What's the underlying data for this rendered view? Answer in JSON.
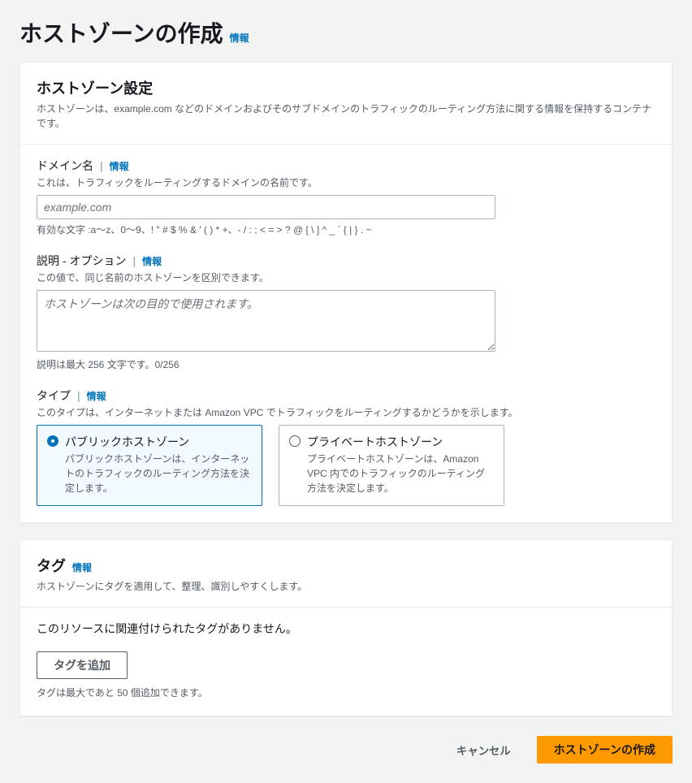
{
  "header": {
    "title": "ホストゾーンの作成",
    "info": "情報"
  },
  "config": {
    "title": "ホストゾーン設定",
    "desc": "ホストゾーンは、example.com などのドメインおよびそのサブドメインのトラフィックのルーティング方法に関する情報を保持するコンテナです。",
    "domain": {
      "label": "ドメイン名",
      "info": "情報",
      "help": "これは、トラフィックをルーティングするドメインの名前です。",
      "placeholder": "example.com",
      "constraint": "有効な文字 :a～z、0～9、! \" # $ % & ' ( ) * +、- / : ; < = > ? @ [ \\ ] ^ _ ` { | } . ~"
    },
    "description": {
      "label": "説明 - オプション",
      "info": "情報",
      "help": "この値で、同じ名前のホストゾーンを区別できます。",
      "placeholder": "ホストゾーンは次の目的で使用されます。",
      "constraint": "説明は最大 256 文字です。0/256"
    },
    "type": {
      "label": "タイプ",
      "info": "情報",
      "help": "このタイプは、インターネットまたは Amazon VPC でトラフィックをルーティングするかどうかを示します。",
      "public": {
        "title": "パブリックホストゾーン",
        "desc": "パブリックホストゾーンは、インターネットのトラフィックのルーティング方法を決定します。"
      },
      "private": {
        "title": "プライベートホストゾーン",
        "desc": "プライベートホストゾーンは、Amazon VPC 内でのトラフィックのルーティング方法を決定します。"
      }
    }
  },
  "tags": {
    "title": "タグ",
    "info": "情報",
    "desc": "ホストゾーンにタグを適用して、整理、識別しやすくします。",
    "empty": "このリソースに関連付けられたタグがありません。",
    "addButton": "タグを追加",
    "hint": "タグは最大であと 50 個追加できます。"
  },
  "footer": {
    "cancel": "キャンセル",
    "submit": "ホストゾーンの作成"
  }
}
